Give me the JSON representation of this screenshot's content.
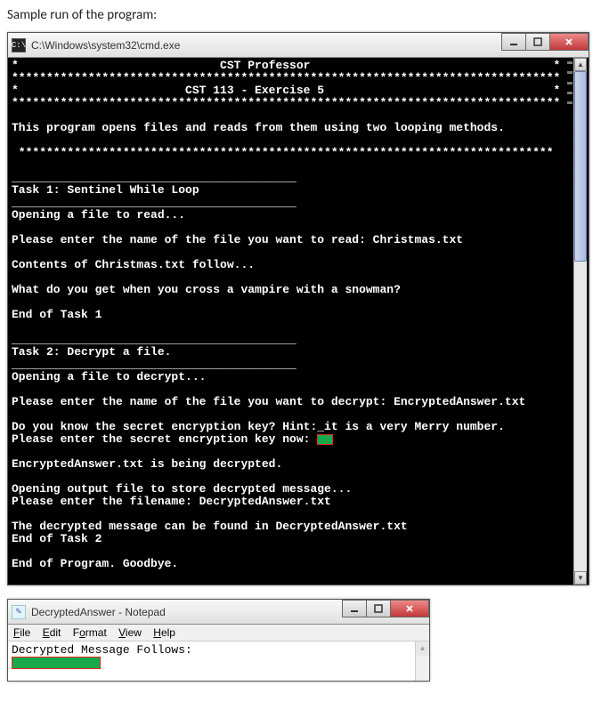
{
  "caption": "Sample run of the program:",
  "cmdWindow": {
    "title": "C:\\Windows\\system32\\cmd.exe",
    "iconLabel": "C:\\",
    "lines": [
      "*                             CST Professor                                   *",
      "*******************************************************************************",
      "*                        CST 113 - Exercise 5                                 *",
      "*******************************************************************************",
      "",
      "This program opens files and reads from them using two looping methods.",
      "",
      " *****************************************************************************",
      "",
      "_________________________________________",
      "Task 1: Sentinel While Loop",
      "_________________________________________",
      "Opening a file to read...",
      "",
      "Please enter the name of the file you want to read: Christmas.txt",
      "",
      "Contents of Christmas.txt follow...",
      "",
      "What do you get when you cross a vampire with a snowman?",
      "",
      "End of Task 1",
      "",
      "_________________________________________",
      "Task 2: Decrypt a file.",
      "_________________________________________",
      "Opening a file to decrypt...",
      "",
      "Please enter the name of the file you want to decrypt: EncryptedAnswer.txt",
      "",
      "Do you know the secret encryption key? Hint:_it is a very Merry number.",
      "Please enter the secret encryption key now: [[RED]]",
      "",
      "EncryptedAnswer.txt is being decrypted.",
      "",
      "Opening output file to store decrypted message...",
      "Please enter the filename: DecryptedAnswer.txt",
      "",
      "The decrypted message can be found in DecryptedAnswer.txt",
      "End of Task 2",
      "",
      "End of Program. Goodbye.",
      ""
    ]
  },
  "notepadWindow": {
    "title": "DecryptedAnswer - Notepad",
    "menu": {
      "file": "File",
      "edit": "Edit",
      "format": "Format",
      "view": "View",
      "help": "Help"
    },
    "bodyLine": "Decrypted Message Follows:"
  }
}
